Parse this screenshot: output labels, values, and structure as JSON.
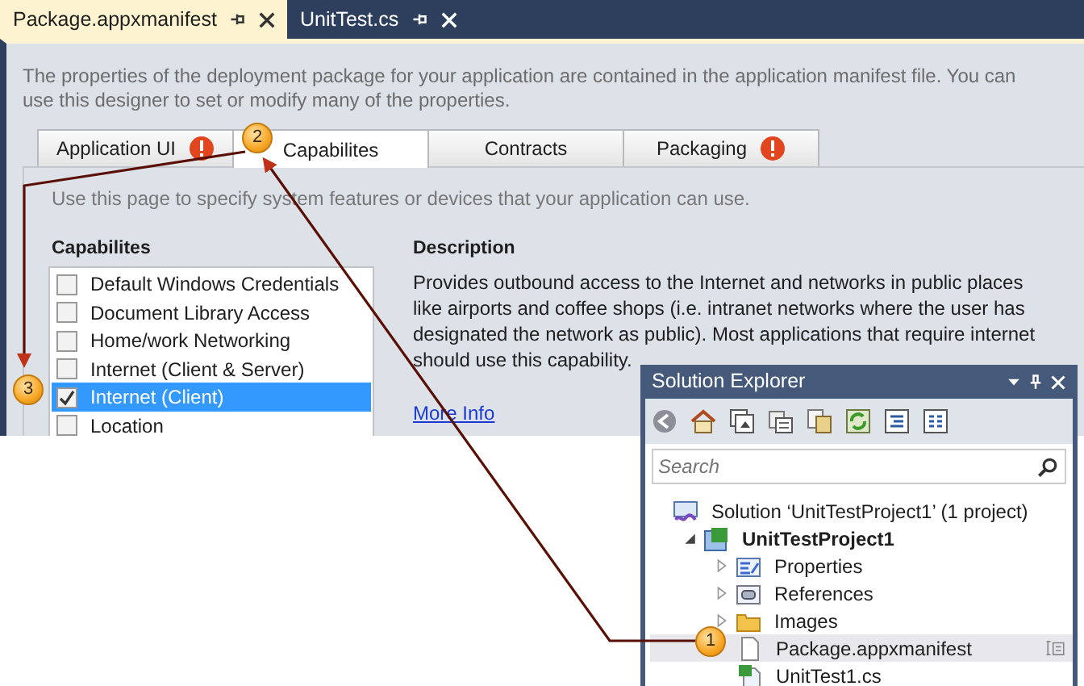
{
  "document_tabs": [
    {
      "label": "Package.appxmanifest",
      "selected": true
    },
    {
      "label": "UnitTest.cs",
      "selected": false
    }
  ],
  "designer": {
    "intro": "The properties of the deployment package for your application are contained in the application manifest file. You can use this designer to set or modify many of the properties.",
    "tabs": [
      {
        "label": "Application UI",
        "selected": false,
        "error": true
      },
      {
        "label": "Capabilites",
        "selected": true,
        "error": false
      },
      {
        "label": "Contracts",
        "selected": false,
        "error": false
      },
      {
        "label": "Packaging",
        "selected": false,
        "error": true
      }
    ],
    "hint": "Use this page to specify system features or devices that your application can use.",
    "capabilities_heading": "Capabilites",
    "capabilities": [
      {
        "label": "Default Windows Credentials",
        "checked": false,
        "selected": false
      },
      {
        "label": "Document Library Access",
        "checked": false,
        "selected": false
      },
      {
        "label": "Home/work Networking",
        "checked": false,
        "selected": false
      },
      {
        "label": "Internet (Client & Server)",
        "checked": false,
        "selected": false
      },
      {
        "label": "Internet (Client)",
        "checked": true,
        "selected": true
      },
      {
        "label": "Location",
        "checked": false,
        "selected": false
      }
    ],
    "description_heading": "Description",
    "description": "Provides outbound access to the Internet and networks in public places like airports and coffee shops (i.e. intranet networks where the user has designated the network as public). Most applications that require internet should use this capability.",
    "more_info": "More Info"
  },
  "solution_explorer": {
    "title": "Solution Explorer",
    "search": {
      "placeholder": "Search"
    },
    "tree": [
      {
        "label": "Solution ‘UnitTestProject1’ (1 project)",
        "kind": "solution",
        "selected": false,
        "children": [
          {
            "label": "UnitTestProject1",
            "kind": "project",
            "expanded": true,
            "selected": false,
            "children": [
              {
                "label": "Properties",
                "kind": "properties",
                "expanded": false,
                "selected": false
              },
              {
                "label": "References",
                "kind": "references",
                "expanded": false,
                "selected": false
              },
              {
                "label": "Images",
                "kind": "folder",
                "expanded": false,
                "selected": false
              },
              {
                "label": "Package.appxmanifest",
                "kind": "file",
                "selected": true
              },
              {
                "label": "UnitTest1.cs",
                "kind": "csfile",
                "selected": false
              }
            ]
          }
        ]
      }
    ]
  },
  "callouts": [
    {
      "number": "1"
    },
    {
      "number": "2"
    },
    {
      "number": "3"
    }
  ]
}
